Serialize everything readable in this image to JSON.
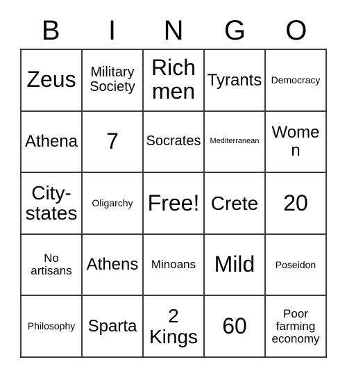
{
  "card": {
    "title": "BINGO",
    "header_letters": [
      "B",
      "I",
      "N",
      "G",
      "O"
    ],
    "free_space_label": "Free!",
    "grid_line_color": "#3a3a3a",
    "background_color": "#ffffff",
    "text_color": "#000000",
    "columns": 5,
    "rows": 5,
    "cells": [
      [
        {
          "text": "Zeus",
          "size": "fs-xxl"
        },
        {
          "text": "Military\nSociety",
          "size": "fs-md"
        },
        {
          "text": "Rich\nmen",
          "size": "fs-xxl"
        },
        {
          "text": "Tyrants",
          "size": "fs-lg"
        },
        {
          "text": "Democracy",
          "size": "fs-xs"
        }
      ],
      [
        {
          "text": "Athena",
          "size": "fs-lg"
        },
        {
          "text": "7",
          "size": "fs-xxl"
        },
        {
          "text": "Socrates",
          "size": "fs-md"
        },
        {
          "text": "Mediterranean",
          "size": "fs-xxs"
        },
        {
          "text": "Women",
          "size": "fs-lg"
        }
      ],
      [
        {
          "text": "City-\nstates",
          "size": "fs-xl"
        },
        {
          "text": "Oligarchy",
          "size": "fs-xs"
        },
        {
          "text": "Free!",
          "size": "fs-xxl"
        },
        {
          "text": "Crete",
          "size": "fs-xl"
        },
        {
          "text": "20",
          "size": "fs-xxl"
        }
      ],
      [
        {
          "text": "No\nartisans",
          "size": "fs-sm"
        },
        {
          "text": "Athens",
          "size": "fs-lg"
        },
        {
          "text": "Minoans",
          "size": "fs-sm"
        },
        {
          "text": "Mild",
          "size": "fs-xxl"
        },
        {
          "text": "Poseidon",
          "size": "fs-xs"
        }
      ],
      [
        {
          "text": "Philosophy",
          "size": "fs-xs"
        },
        {
          "text": "Sparta",
          "size": "fs-lg"
        },
        {
          "text": "2\nKings",
          "size": "fs-xl"
        },
        {
          "text": "60",
          "size": "fs-xxl"
        },
        {
          "text": "Poor\nfarming\neconomy",
          "size": "fs-sm"
        }
      ]
    ]
  }
}
